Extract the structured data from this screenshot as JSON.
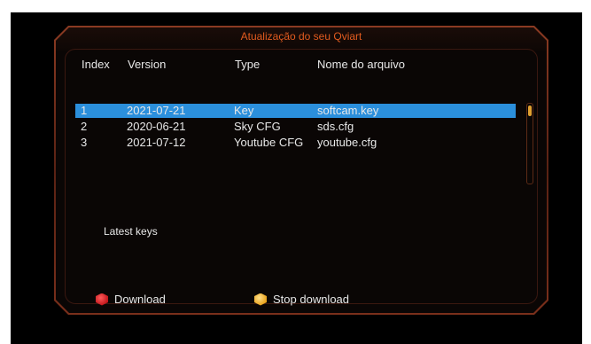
{
  "dialog": {
    "title": "Atualização do seu Qviart"
  },
  "table": {
    "headers": {
      "index": "Index",
      "version": "Version",
      "type": "Type",
      "filename": "Nome do arquivo"
    },
    "rows": [
      {
        "index": "1",
        "version": "2021-07-21",
        "type": "Key",
        "filename": "softcam.key",
        "selected": true
      },
      {
        "index": "2",
        "version": "2020-06-21",
        "type": "Sky CFG",
        "filename": "sds.cfg",
        "selected": false
      },
      {
        "index": "3",
        "version": "2021-07-12",
        "type": "Youtube CFG",
        "filename": "youtube.cfg",
        "selected": false
      }
    ]
  },
  "info": {
    "text": "Latest keys"
  },
  "footer": {
    "red_label": "Download",
    "yellow_label": "Stop download"
  },
  "colors": {
    "title": "#e25b1f",
    "selection": "#2b8fdc",
    "frame": "#8a3a22",
    "red_key": "#c0151a",
    "yellow_key": "#e8a018"
  },
  "icons": {
    "red_key": "red-hexagon-icon",
    "yellow_key": "yellow-hexagon-icon"
  }
}
